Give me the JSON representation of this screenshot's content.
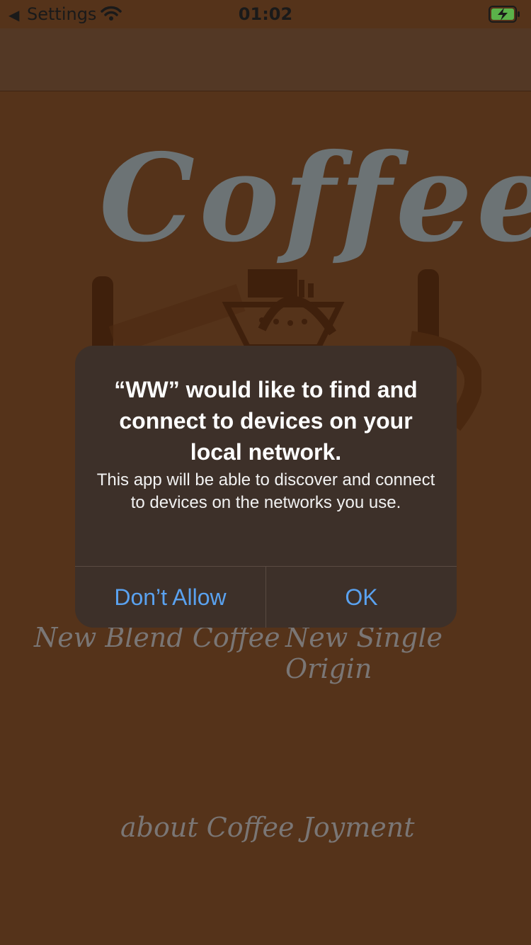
{
  "status_bar": {
    "back_label": "Settings",
    "time": "01:02"
  },
  "hero": {
    "title": "Coffee"
  },
  "menu": {
    "new_blend": "New Blend Coffee",
    "new_single_origin": "New Single Origin",
    "about": "about Coffee Joyment"
  },
  "alert": {
    "title": "“WW” would like to find and connect to devices on your local network.",
    "message": "This app will be able to discover and connect to devices on the networks you use.",
    "dont_allow_label": "Don’t Allow",
    "ok_label": "OK"
  },
  "colors": {
    "background": "#55331a",
    "nav_bar": "#533825",
    "alert_background": "#3d3029",
    "accent_blue": "#5aa2f0",
    "title_gray": "#6c7375"
  },
  "icons": [
    "back-caret-icon",
    "wifi-icon",
    "battery-charging-icon",
    "coffee-cup-logo"
  ]
}
